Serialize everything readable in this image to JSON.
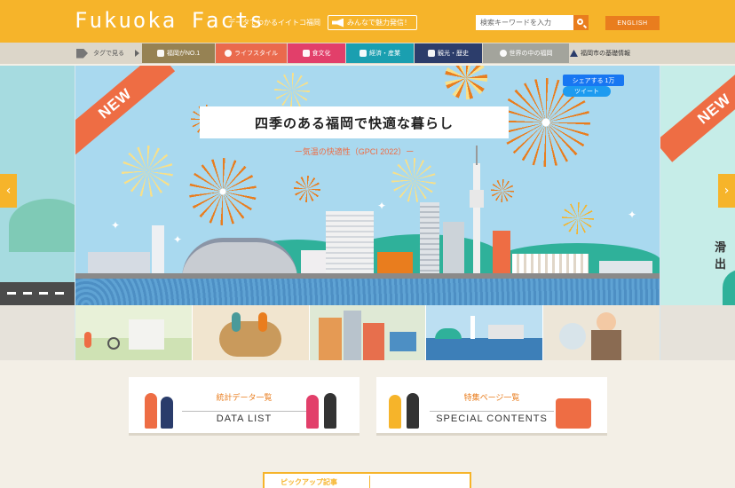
{
  "header": {
    "logo": "Fukuoka Facts",
    "tagline": "データでわかるイイトコ福岡",
    "post_button": "みんなで魅力発信！",
    "search_placeholder": "検索キーワードを入力",
    "english_button": "ENGLISH",
    "colors": {
      "bar": "#f6b42a",
      "accent": "#e97d1e"
    }
  },
  "tagnav": {
    "lead": "タグで見る",
    "tags": [
      {
        "label": "福岡がNO.1",
        "color": "#968253"
      },
      {
        "label": "ライフスタイル",
        "color": "#ea6a4d"
      },
      {
        "label": "食文化",
        "color": "#e23f6a"
      },
      {
        "label": "経済・産業",
        "color": "#1a9fb0"
      },
      {
        "label": "観光・歴史",
        "color": "#2c3d6b"
      },
      {
        "label": "世界の中の福岡",
        "color": "#a3a49c"
      }
    ],
    "last": "福岡市の基礎情報"
  },
  "hero": {
    "badge": "NEW",
    "title": "四季のある福岡で快適な暮らし",
    "subtitle": "ー気温の快適性（GPCI 2022）ー",
    "share_label": "シェアする 1万",
    "tweet_label": "ツイート",
    "right_peek_text": "滑出"
  },
  "cards": [
    {
      "heading": "統計データ一覧",
      "sub": "DATA LIST"
    },
    {
      "heading": "特集ページ一覧",
      "sub": "SPECIAL CONTENTS"
    }
  ],
  "bottom_card": {
    "label": "ピックアップ記事"
  }
}
